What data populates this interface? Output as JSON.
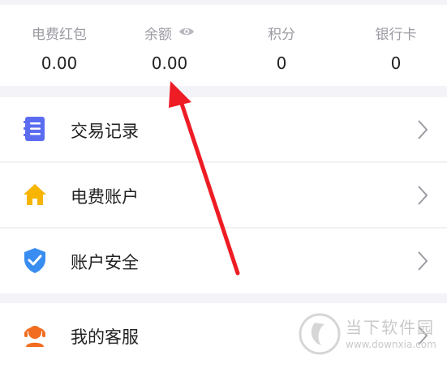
{
  "stats": [
    {
      "label": "电费红包",
      "value": "0.00"
    },
    {
      "label": "余额",
      "value": "0.00",
      "has_eye": true
    },
    {
      "label": "积分",
      "value": "0"
    },
    {
      "label": "银行卡",
      "value": "0"
    }
  ],
  "menu": [
    {
      "label": "交易记录",
      "icon": "list-icon",
      "icon_color": "#5b6cf0"
    },
    {
      "label": "电费账户",
      "icon": "home-icon",
      "icon_color": "#f7b500"
    },
    {
      "label": "账户安全",
      "icon": "shield-check-icon",
      "icon_color": "#3a8df0"
    },
    {
      "label": "我的客服",
      "icon": "customer-service-icon",
      "icon_color": "#f26d1f"
    }
  ],
  "annotation": {
    "arrow_color": "#ee1c25"
  },
  "watermark": {
    "text": "当下软件园",
    "url": "www.downxia.com"
  }
}
